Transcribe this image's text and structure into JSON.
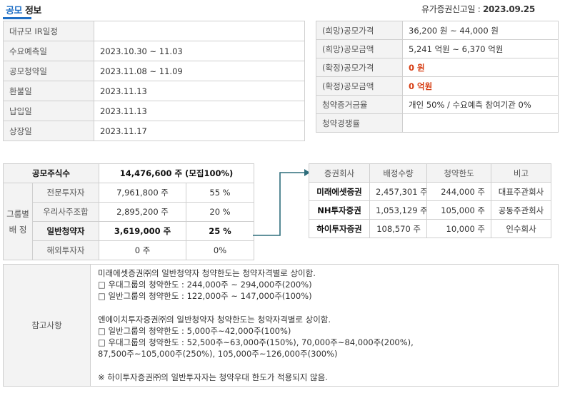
{
  "header": {
    "title_highlight": "공모",
    "title_rest": " 정보",
    "filing_label": "유가증권신고일 : ",
    "filing_date": "2023.09.25"
  },
  "schedule": [
    {
      "label": "대규모 IR일정",
      "value": ""
    },
    {
      "label": "수요예측일",
      "value": "2023.10.30 ~ 11.03"
    },
    {
      "label": "공모청약일",
      "value": "2023.11.08 ~ 11.09"
    },
    {
      "label": "환불일",
      "value": "2023.11.13"
    },
    {
      "label": "납입일",
      "value": "2023.11.13"
    },
    {
      "label": "상장일",
      "value": "2023.11.17"
    }
  ],
  "pricing": [
    {
      "label": "(희망)공모가격",
      "value": "36,200 원 ~ 44,000 원",
      "highlight": false
    },
    {
      "label": "(희망)공모금액",
      "value": "5,241 억원  ~ 6,370 억원",
      "highlight": false
    },
    {
      "label": "(확정)공모가격",
      "value": "0 원",
      "highlight": true
    },
    {
      "label": "(확정)공모금액",
      "value": "0 억원",
      "highlight": true
    },
    {
      "label": "청약증거금율",
      "value": "개인 50% / 수요예측 참여기관 0%",
      "highlight": false
    },
    {
      "label": "청약경쟁률",
      "value": "",
      "highlight": false
    }
  ],
  "shares": {
    "total_label": "공모주식수",
    "total_value": "14,476,600 주 (모집100%)",
    "group_label_1": "그룹별",
    "group_label_2": "배 정",
    "groups": [
      {
        "label": "전문투자자",
        "shares": "7,961,800 주",
        "pct": "55 %"
      },
      {
        "label": "우리사주조합",
        "shares": "2,895,200 주",
        "pct": "20 %"
      },
      {
        "label": "일반청약자",
        "shares": "3,619,000 주",
        "pct": "25 %"
      },
      {
        "label": "해외투자자",
        "shares": "0 주",
        "pct": "0%"
      }
    ]
  },
  "underwriters": {
    "headers": [
      "증권회사",
      "배정수량",
      "청약한도",
      "비고"
    ],
    "rows": [
      {
        "name": "미래에셋증권",
        "qty": "2,457,301 주",
        "limit": "244,000 주",
        "note": "대표주관회사"
      },
      {
        "name": "NH투자증권",
        "qty": "1,053,129 주",
        "limit": "105,000 주",
        "note": "공동주관회사"
      },
      {
        "name": "하이투자증권",
        "qty": "108,570 주",
        "limit": "10,000 주",
        "note": "인수회사"
      }
    ]
  },
  "notes": {
    "label": "참고사항",
    "lines": [
      "미래에셋증권㈜의 일반청약자 청약한도는 청약자격별로 상이함.",
      "□ 우대그룹의 청약한도 : 244,000주 ~ 294,000주(200%)",
      "□ 일반그룹의 청약한도 : 122,000주 ~ 147,000주(100%)",
      "",
      "엔에이치투자증권㈜의 일반청약자 청약한도는 청약자격별로 상이함.",
      "□ 일반그룹의 청약한도 : 5,000주~42,000주(100%)",
      "□ 우대그룹의 청약한도 : 52,500주~63,000주(150%), 70,000주~84,000주(200%),",
      "87,500주~105,000주(250%), 105,000주~126,000주(300%)",
      "",
      "※ 하이투자증권㈜의 일반투자자는 청약우대 한도가 적용되지 않음."
    ]
  }
}
